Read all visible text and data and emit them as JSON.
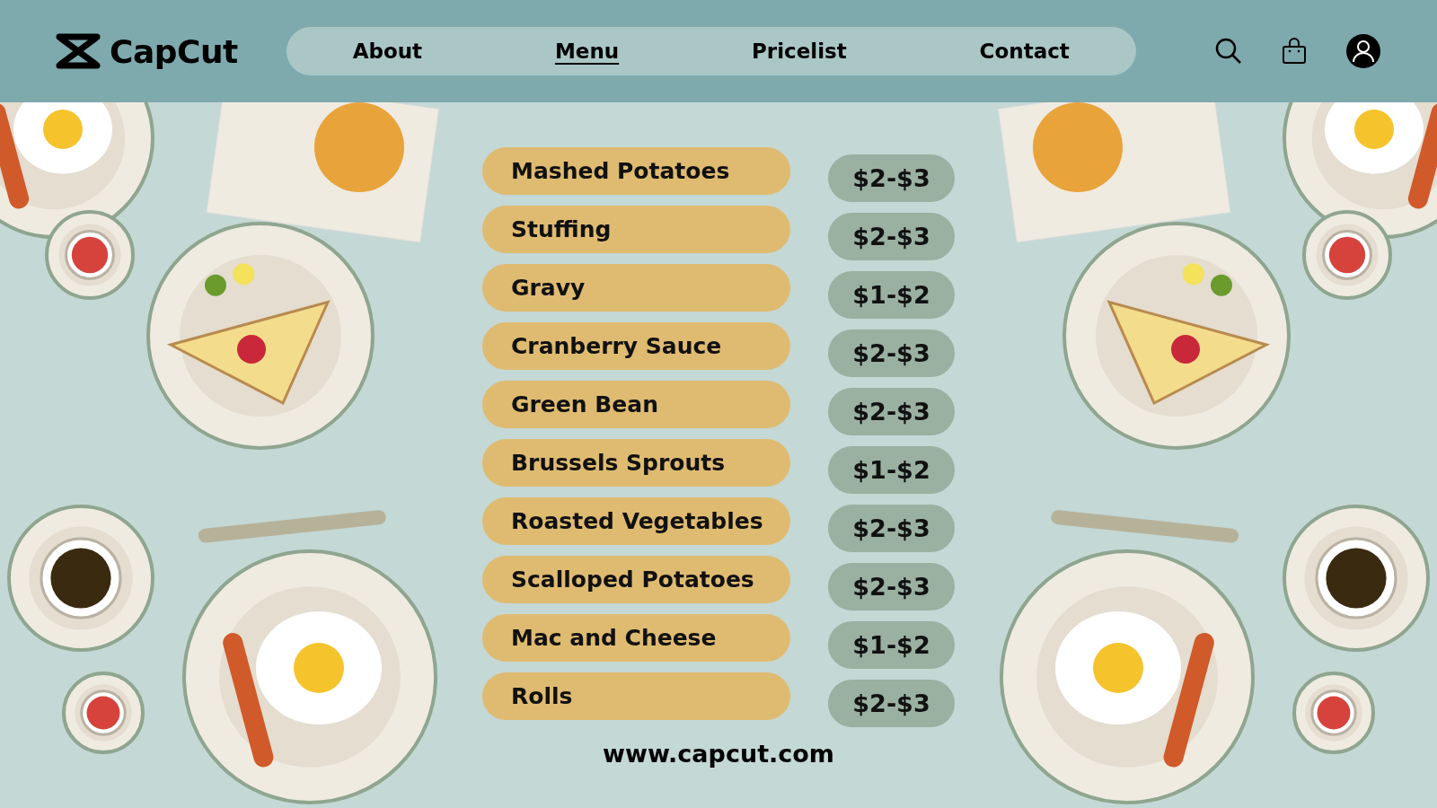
{
  "brand": {
    "name": "CapCut"
  },
  "nav": [
    {
      "label": "About",
      "selected": false
    },
    {
      "label": "Menu",
      "selected": true
    },
    {
      "label": "Pricelist",
      "selected": false
    },
    {
      "label": "Contact",
      "selected": false
    }
  ],
  "menu_items": [
    {
      "name": "Mashed Potatoes",
      "price": "$2-$3"
    },
    {
      "name": "Stuffing",
      "price": "$2-$3"
    },
    {
      "name": "Gravy",
      "price": "$1-$2"
    },
    {
      "name": "Cranberry Sauce",
      "price": "$2-$3"
    },
    {
      "name": "Green Bean",
      "price": "$2-$3"
    },
    {
      "name": "Brussels Sprouts",
      "price": "$1-$2"
    },
    {
      "name": "Roasted Vegetables",
      "price": "$2-$3"
    },
    {
      "name": "Scalloped Potatoes",
      "price": "$2-$3"
    },
    {
      "name": "Mac and Cheese",
      "price": "$1-$2"
    },
    {
      "name": "Rolls",
      "price": "$2-$3"
    }
  ],
  "footer": {
    "url": "www.capcut.com"
  }
}
